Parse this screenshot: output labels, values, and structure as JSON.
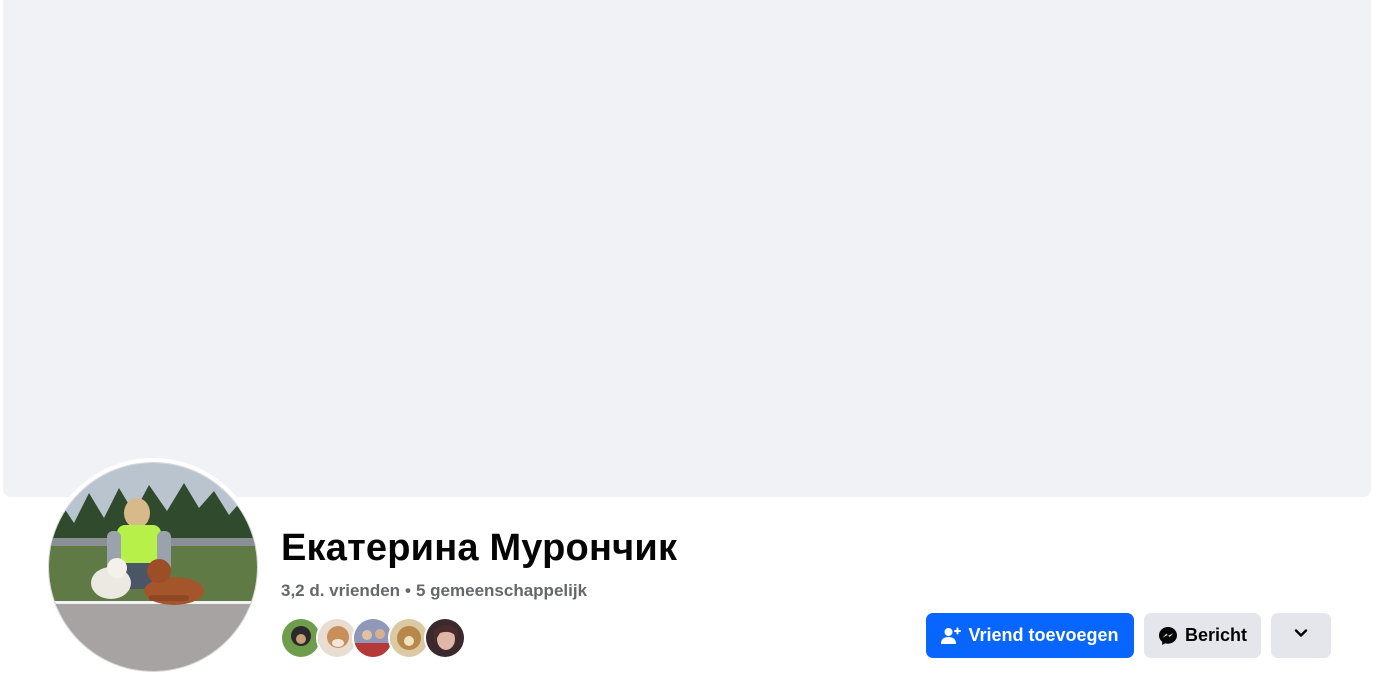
{
  "profile": {
    "name": "Екатерина Мурончик",
    "friends_count": "3,2 d. vrienden",
    "separator": "•",
    "mutual_count": "5 gemeenschappelijk",
    "avatar_icon": "profile-photo",
    "mutual_friend_avatars": [
      "mutual-avatar-1",
      "mutual-avatar-2",
      "mutual-avatar-3",
      "mutual-avatar-4",
      "mutual-avatar-5"
    ]
  },
  "actions": {
    "add_friend_label": "Vriend toevoegen",
    "add_friend_icon": "person-plus-icon",
    "message_label": "Bericht",
    "message_icon": "messenger-icon",
    "more_icon": "chevron-down-icon"
  },
  "colors": {
    "primary": "#0866ff",
    "secondary_bg": "#e4e6eb",
    "cover_bg": "#f1f2f6",
    "meta_text": "#65676b"
  }
}
